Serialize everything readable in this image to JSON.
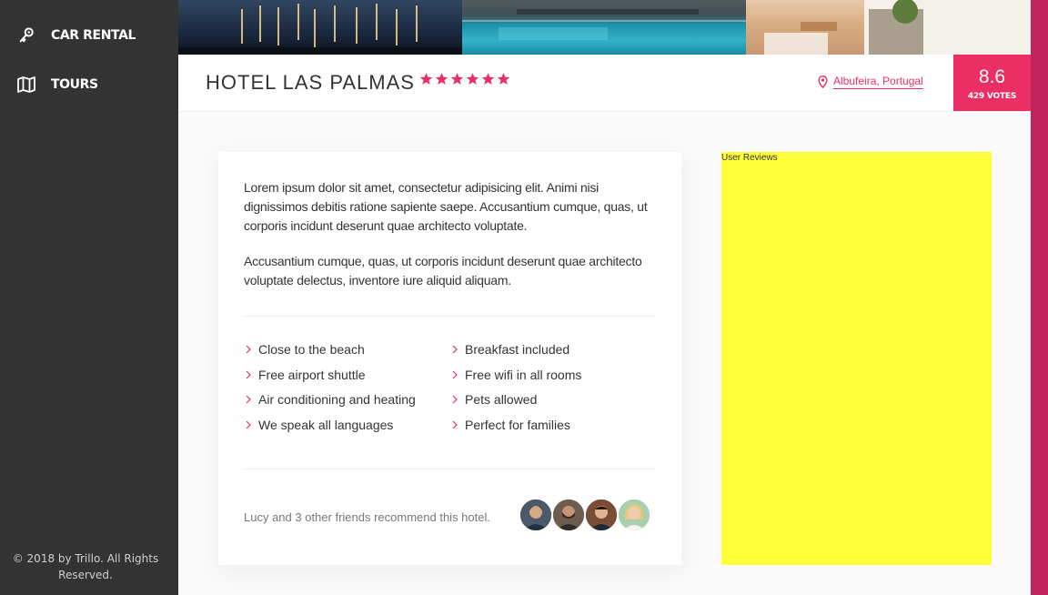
{
  "sidebar": {
    "items": [
      {
        "label": "CAR RENTAL",
        "icon": "key-icon"
      },
      {
        "label": "TOURS",
        "icon": "map-icon"
      }
    ],
    "legal": "© 2018 by Trillo. All Rights Reserved."
  },
  "hotel": {
    "name": "HOTEL LAS PALMAS",
    "stars": 6,
    "location": "Albufeira, Portugal",
    "rating": "8.6",
    "votes": "429 VOTES"
  },
  "description": {
    "paragraphs": [
      "Lorem ipsum dolor sit amet, consectetur adipisicing elit. Animi nisi dignissimos debitis ratione sapiente saepe. Accusantium cumque, quas, ut corporis incidunt deserunt quae architecto voluptate.",
      "Accusantium cumque, quas, ut corporis incidunt deserunt quae architecto voluptate delectus, inventore iure aliquid aliquam."
    ],
    "features": [
      "Close to the beach",
      "Breakfast included",
      "Free airport shuttle",
      "Free wifi in all rooms",
      "Air conditioning and heating",
      "Pets allowed",
      "We speak all languages",
      "Perfect for families"
    ],
    "recommend": "Lucy and 3 other friends recommend this hotel."
  },
  "reviews": {
    "label": "User Reviews"
  },
  "colors": {
    "accent": "#eb2f64",
    "sidebar": "#333333",
    "reviews_bg": "#ffff3a"
  }
}
